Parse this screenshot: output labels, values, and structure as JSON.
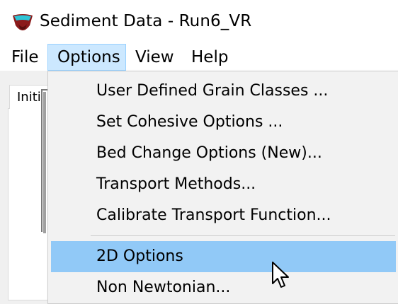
{
  "window": {
    "title": "Sediment Data - Run6_VR",
    "icon": "hec-ras-app-icon"
  },
  "menubar": {
    "items": [
      {
        "label": "File"
      },
      {
        "label": "Options",
        "state": "open"
      },
      {
        "label": "View"
      },
      {
        "label": "Help"
      }
    ]
  },
  "tabs": [
    {
      "label": "Initia"
    }
  ],
  "options_menu": {
    "items": [
      {
        "label": "User Defined Grain Classes ..."
      },
      {
        "label": "Set Cohesive Options ..."
      },
      {
        "label": "Bed Change Options (New)..."
      },
      {
        "label": "Transport Methods..."
      },
      {
        "label": "Calibrate Transport Function..."
      },
      {
        "label": "2D Options",
        "highlighted": true
      },
      {
        "label": "Non Newtonian..."
      }
    ]
  },
  "colors": {
    "menu_open_bg": "#cce8ff",
    "menu_highlight": "#91c9f7",
    "icon_cyan": "#2ec4d6",
    "icon_maroon": "#8b1a1a"
  }
}
